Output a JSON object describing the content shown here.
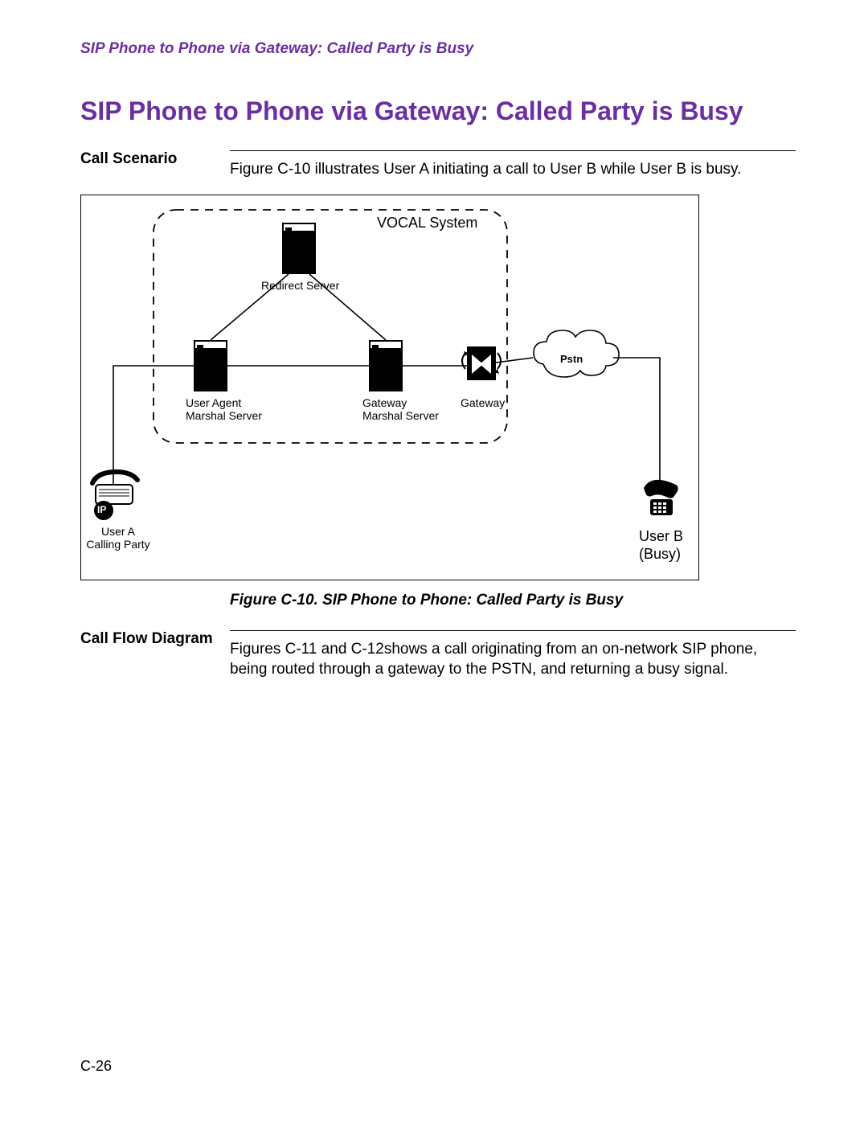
{
  "running_header": "SIP Phone to Phone via Gateway: Called Party is Busy",
  "section_title": "SIP Phone to Phone via Gateway: Called Party is Busy",
  "scenario_label": "Call Scenario",
  "scenario_text": "Figure C-10 illustrates User A initiating a call to User B while User B is busy.",
  "flow_label": "Call Flow Diagram",
  "flow_text": "Figures C-11 and C-12shows a call originating from an on-network SIP phone, being routed through a gateway to the PSTN, and returning a busy signal.",
  "figure_caption": "Figure C-10. SIP Phone to Phone: Called Party is Busy",
  "page_number": "C-26",
  "diagram": {
    "vocal_system": "VOCAL System",
    "redirect_server": "Redirect Server",
    "ua_marshal_l1": "User Agent",
    "ua_marshal_l2": "Marshal Server",
    "gw_marshal_l1": "Gateway",
    "gw_marshal_l2": "Marshal Server",
    "gateway": "Gateway",
    "pstn": "Pstn",
    "user_a_l1": "User A",
    "user_a_l2": "Calling Party",
    "user_b_l1": "User B",
    "user_b_l2": "(Busy)",
    "ip_badge": "IP"
  }
}
